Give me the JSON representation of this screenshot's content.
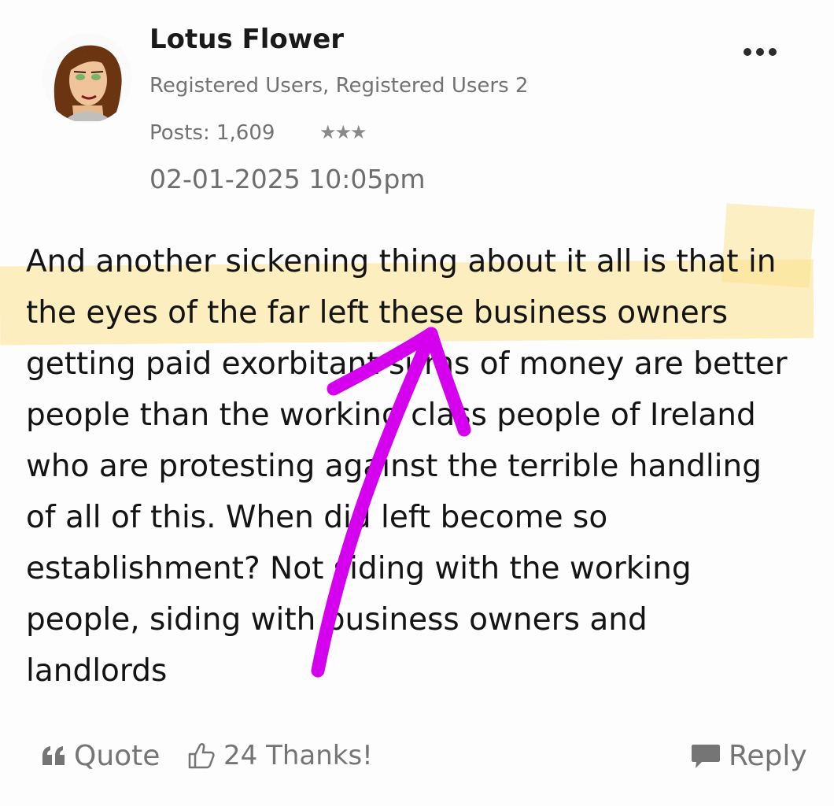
{
  "post": {
    "author": {
      "name": "Lotus Flower",
      "roles": "Registered Users, Registered Users 2",
      "posts_text": "Posts: 1,609",
      "rank_stars": 3
    },
    "timestamp": "02-01-2025 10:05pm",
    "body_lines": [
      "And another sickening thing about it all is that in",
      "the eyes of the far left these business owners",
      "getting paid exorbitant sums of money are better",
      "people than the working class people of Ireland",
      "who are protesting against the terrible handling",
      "of all of this. When did left become so",
      "establishment? Not siding with the working",
      "people, siding with business owners and",
      "landlords"
    ]
  },
  "actions": {
    "quote_label": "Quote",
    "thanks_count": "24",
    "thanks_label": "Thanks!",
    "reply_label": "Reply"
  },
  "icons": {
    "more": "more-options-icon",
    "quote": "quote-icon",
    "thanks": "thumbs-up-icon",
    "reply": "speech-bubble-icon",
    "rank": "star-icon"
  },
  "colors": {
    "highlight": "#fce18c",
    "annotation_arrow": "#d400ee",
    "secondary_text": "#727272"
  }
}
